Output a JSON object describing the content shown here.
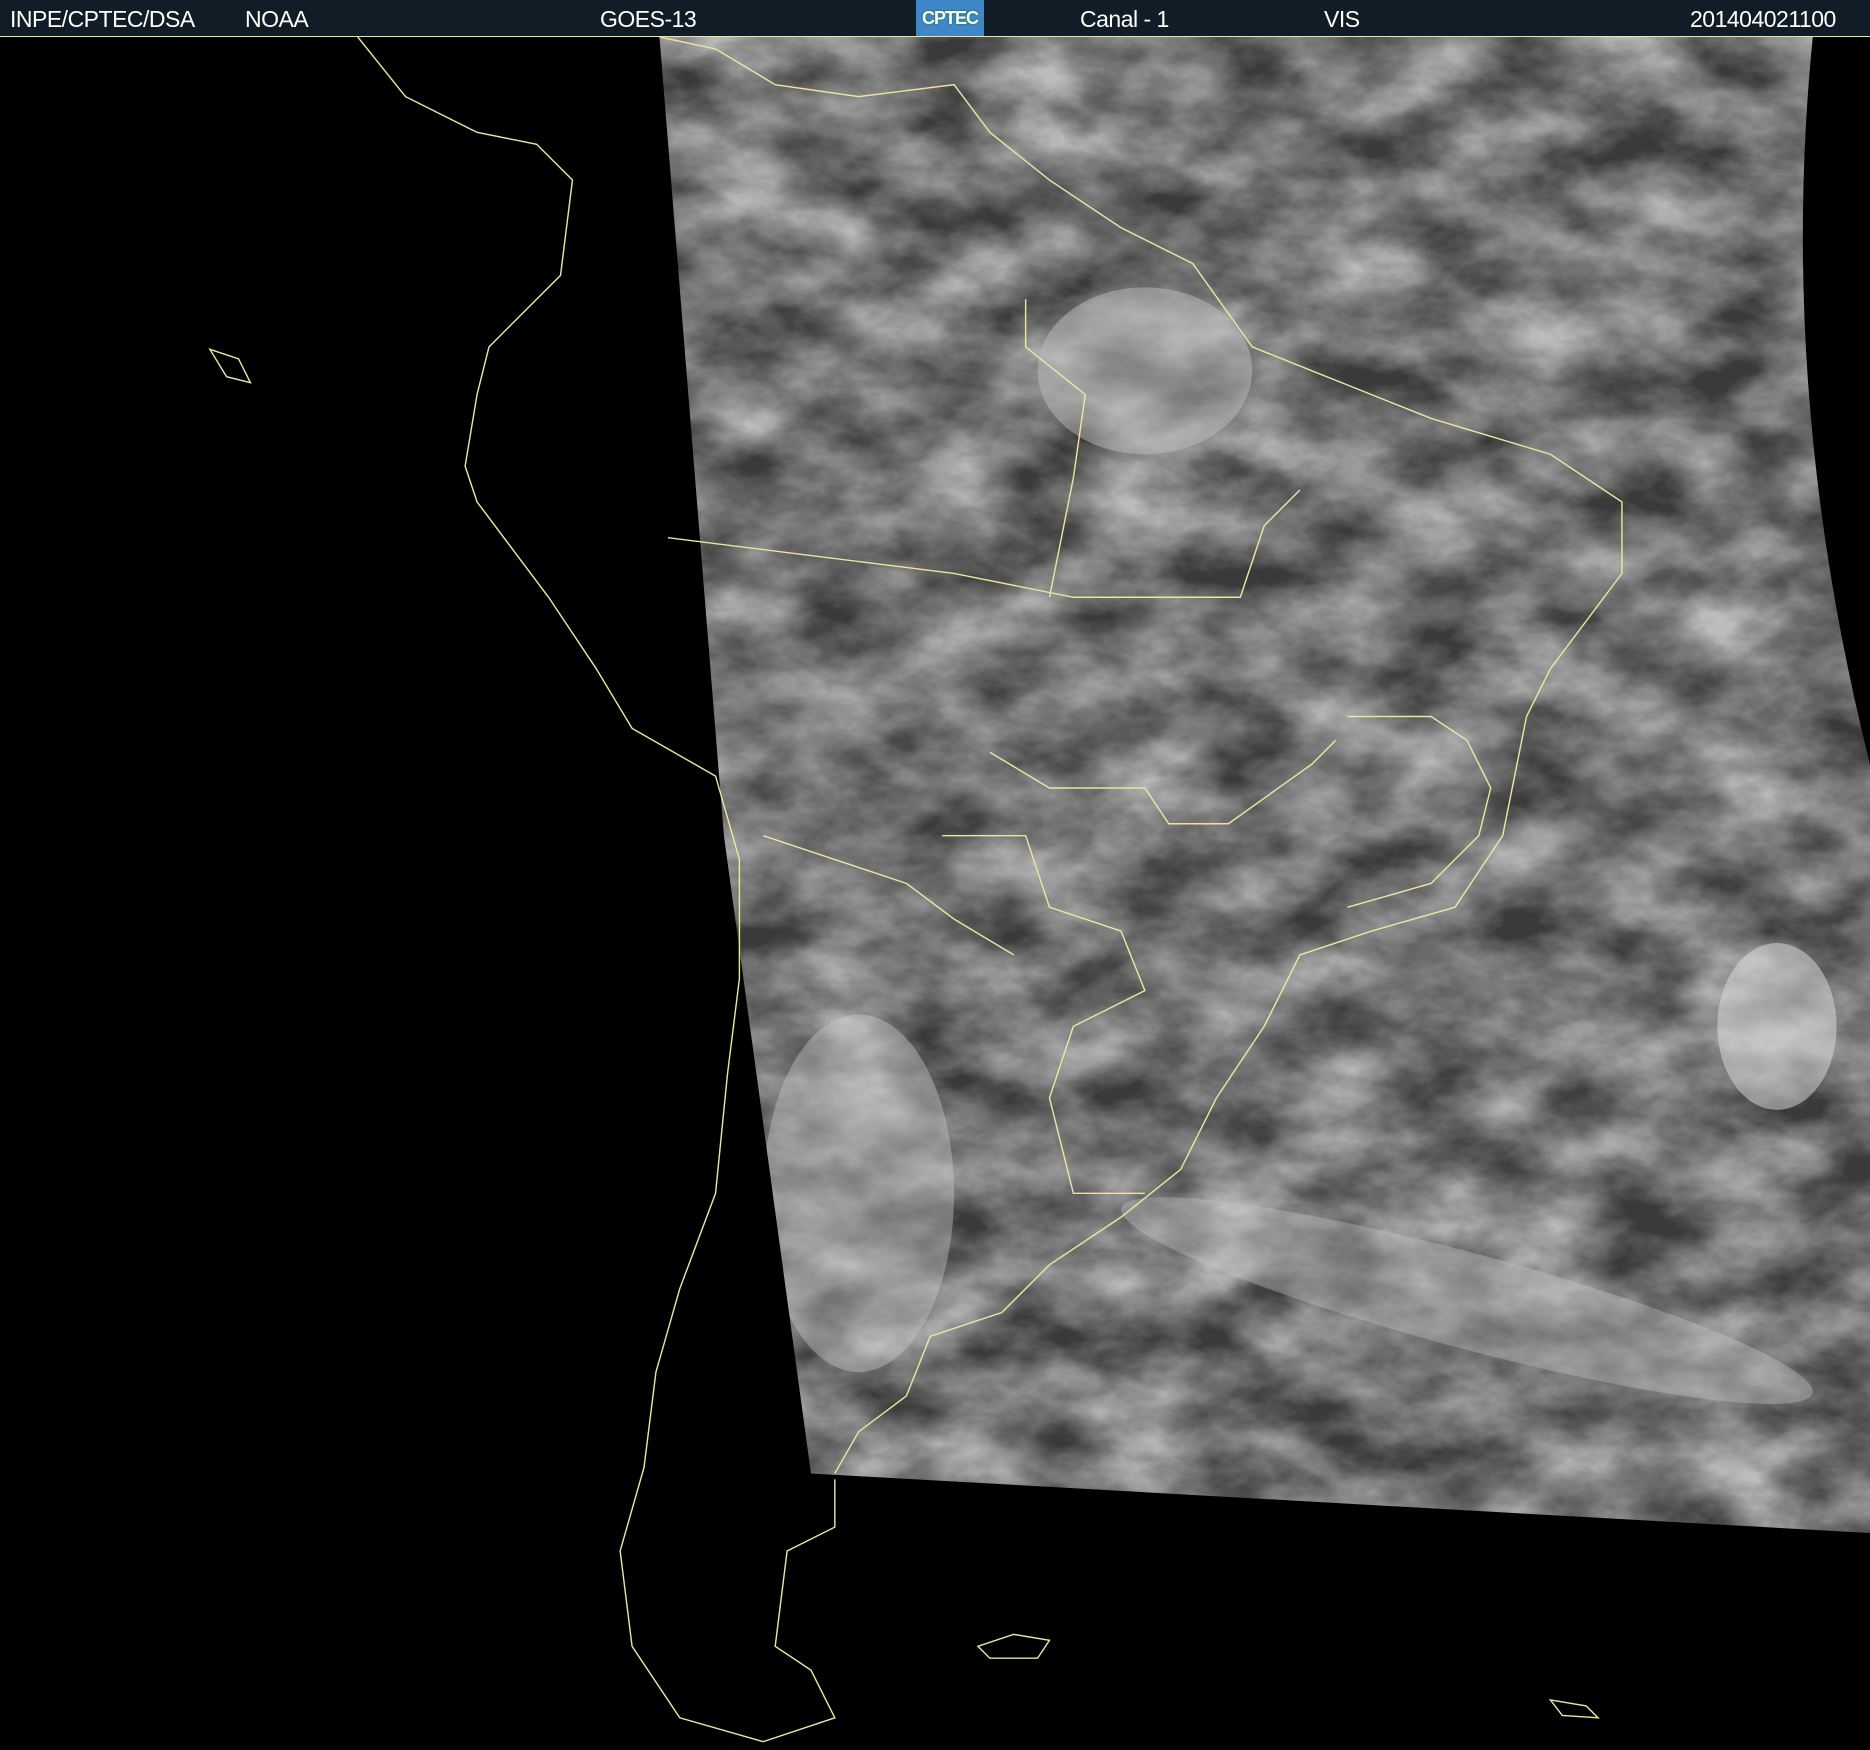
{
  "header": {
    "institution": "INPE/CPTEC/DSA",
    "agency": "NOAA",
    "satellite": "GOES-13",
    "logo_text": "CPTEC",
    "channel": "Canal - 1",
    "band": "VIS",
    "timestamp": "201404021100"
  },
  "colors": {
    "header_bg": "#101c26",
    "outline": "#e8e6a0",
    "logo_bg": "#3f88c8"
  }
}
